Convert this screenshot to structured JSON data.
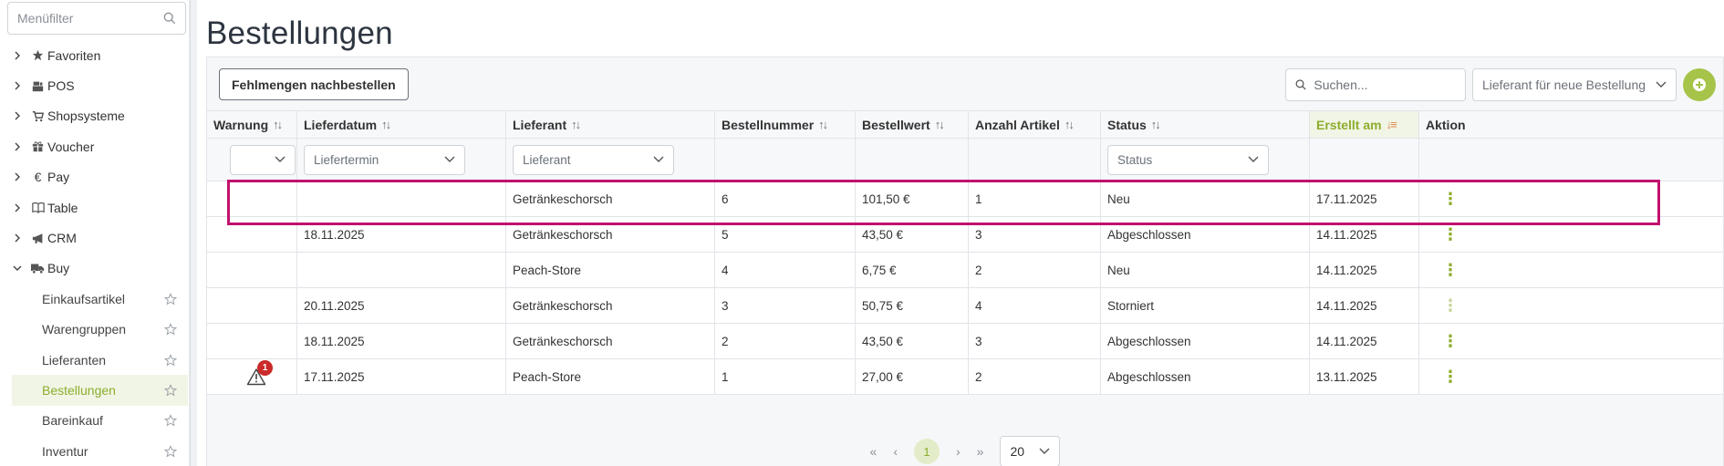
{
  "sidebar": {
    "filter_placeholder": "Menüfilter",
    "items": [
      {
        "label": "Favoriten",
        "icon": "star-icon"
      },
      {
        "label": "POS",
        "icon": "register-icon"
      },
      {
        "label": "Shopsysteme",
        "icon": "cart-icon"
      },
      {
        "label": "Voucher",
        "icon": "gift-icon"
      },
      {
        "label": "Pay",
        "icon": "euro-icon"
      },
      {
        "label": "Table",
        "icon": "book-icon"
      },
      {
        "label": "CRM",
        "icon": "megaphone-icon"
      },
      {
        "label": "Buy",
        "icon": "truck-icon"
      }
    ],
    "subitems": [
      {
        "label": "Einkaufsartikel"
      },
      {
        "label": "Warengruppen"
      },
      {
        "label": "Lieferanten"
      },
      {
        "label": "Bestellungen",
        "active": true
      },
      {
        "label": "Bareinkauf"
      },
      {
        "label": "Inventur"
      }
    ]
  },
  "page": {
    "title": "Bestellungen"
  },
  "toolbar": {
    "reorder_label": "Fehlmengen nachbestellen",
    "search_placeholder": "Suchen...",
    "supplier_select": "Lieferant für neue Bestellung"
  },
  "table": {
    "columns": [
      "Warnung",
      "Lieferdatum",
      "Lieferant",
      "Bestellnummer",
      "Bestellwert",
      "Anzahl Artikel",
      "Status",
      "Erstellt am",
      "Aktion"
    ],
    "filters": {
      "warnung": "",
      "lieferdatum": "Liefertermin",
      "lieferant": "Lieferant",
      "status": "Status"
    },
    "rows": [
      {
        "warnung": "",
        "lieferdatum": "",
        "lieferant": "Getränkeschorsch",
        "nr": "6",
        "wert": "101,50 €",
        "anzahl": "1",
        "status": "Neu",
        "erstellt": "17.11.2025"
      },
      {
        "warnung": "",
        "lieferdatum": "18.11.2025",
        "lieferant": "Getränkeschorsch",
        "nr": "5",
        "wert": "43,50 €",
        "anzahl": "3",
        "status": "Abgeschlossen",
        "erstellt": "14.11.2025"
      },
      {
        "warnung": "",
        "lieferdatum": "",
        "lieferant": "Peach-Store",
        "nr": "4",
        "wert": "6,75 €",
        "anzahl": "2",
        "status": "Neu",
        "erstellt": "14.11.2025"
      },
      {
        "warnung": "",
        "lieferdatum": "20.11.2025",
        "lieferant": "Getränkeschorsch",
        "nr": "3",
        "wert": "50,75 €",
        "anzahl": "4",
        "status": "Storniert",
        "erstellt": "14.11.2025"
      },
      {
        "warnung": "",
        "lieferdatum": "18.11.2025",
        "lieferant": "Getränkeschorsch",
        "nr": "2",
        "wert": "43,50 €",
        "anzahl": "3",
        "status": "Abgeschlossen",
        "erstellt": "14.11.2025"
      },
      {
        "warnung": "1",
        "lieferdatum": "17.11.2025",
        "lieferant": "Peach-Store",
        "nr": "1",
        "wert": "27,00 €",
        "anzahl": "2",
        "status": "Abgeschlossen",
        "erstellt": "13.11.2025"
      }
    ]
  },
  "pager": {
    "current": "1",
    "page_size": "20"
  },
  "colors": {
    "accent": "#8dad2c",
    "highlight": "#c1126e",
    "badge": "#cc2a2a"
  }
}
